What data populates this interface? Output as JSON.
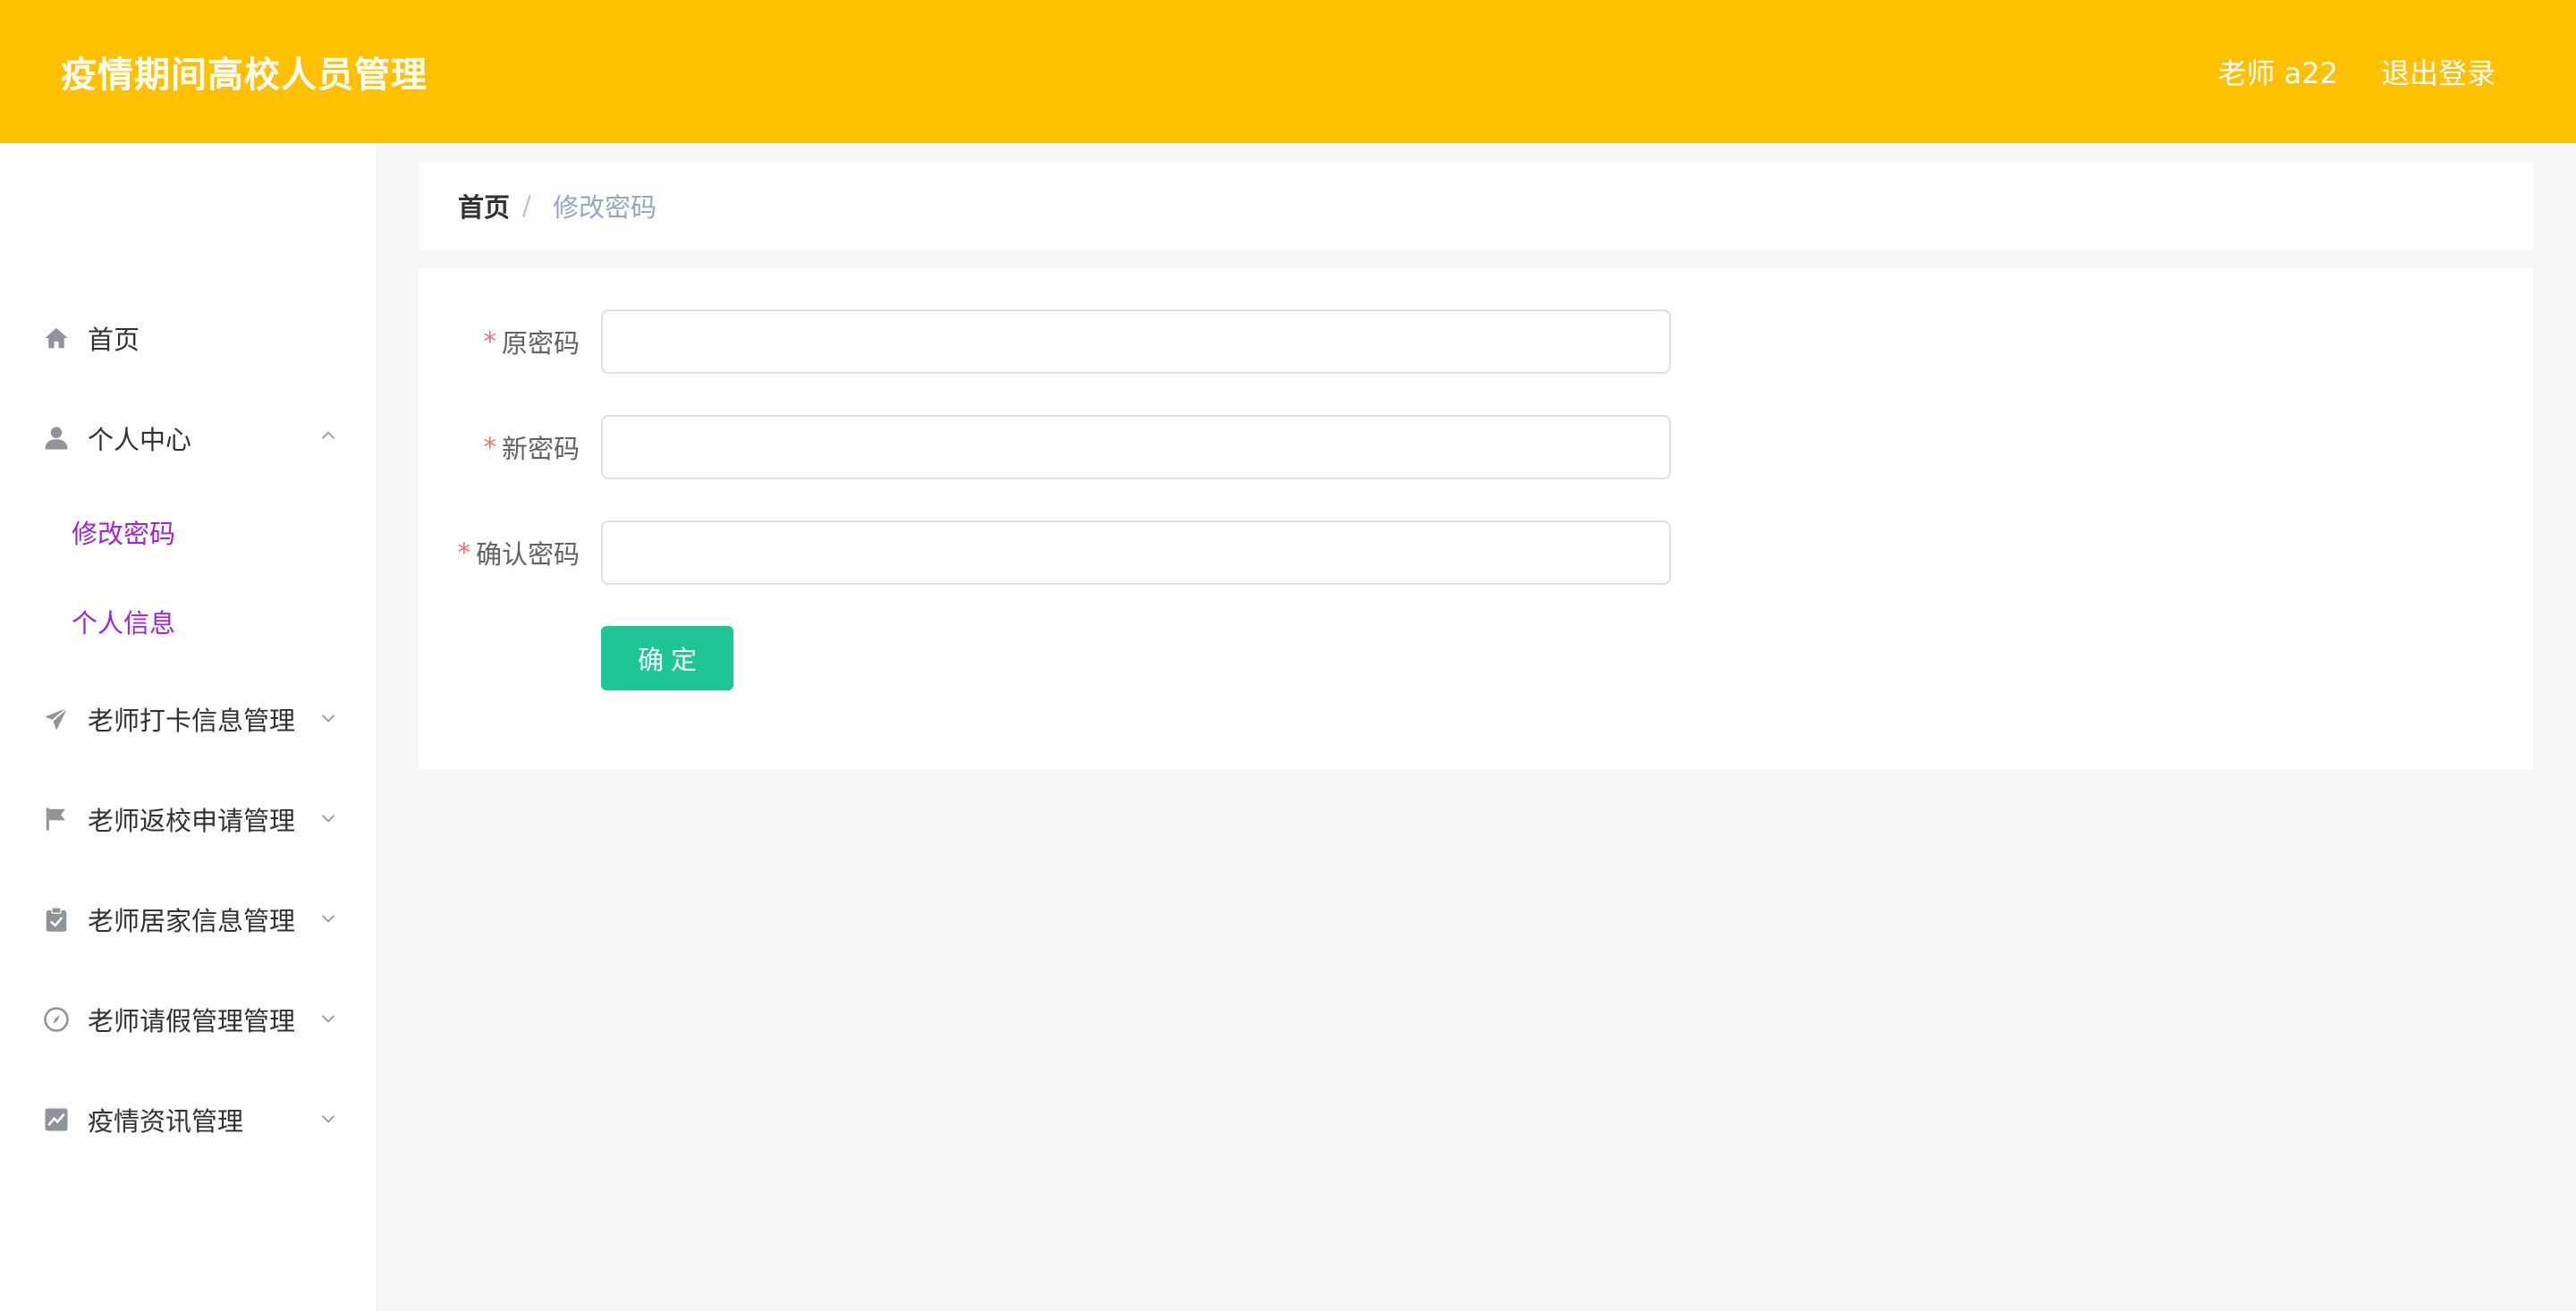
{
  "header": {
    "title": "疫情期间高校人员管理",
    "user": "老师 a22",
    "logout": "退出登录",
    "background": "#ffc000"
  },
  "sidebar": {
    "items": [
      {
        "label": "首页",
        "icon": "home-icon"
      },
      {
        "label": "个人中心",
        "icon": "user-icon",
        "expanded": true,
        "children": [
          {
            "label": "修改密码"
          },
          {
            "label": "个人信息"
          }
        ]
      },
      {
        "label": "老师打卡信息管理",
        "icon": "paper-plane-icon"
      },
      {
        "label": "老师返校申请管理",
        "icon": "flag-icon"
      },
      {
        "label": "老师居家信息管理",
        "icon": "clipboard-check-icon"
      },
      {
        "label": "老师请假管理管理",
        "icon": "compass-icon"
      },
      {
        "label": "疫情资讯管理",
        "icon": "chart-line-icon"
      }
    ],
    "sub_color": "#9a27d6"
  },
  "breadcrumb": {
    "home": "首页",
    "separator": "/",
    "current": "修改密码"
  },
  "form": {
    "required_mark": "*",
    "fields": [
      {
        "label": "原密码",
        "value": "",
        "placeholder": ""
      },
      {
        "label": "新密码",
        "value": "",
        "placeholder": ""
      },
      {
        "label": "确认密码",
        "value": "",
        "placeholder": ""
      }
    ],
    "submit_label": "确定",
    "submit_color": "#1dc694"
  }
}
